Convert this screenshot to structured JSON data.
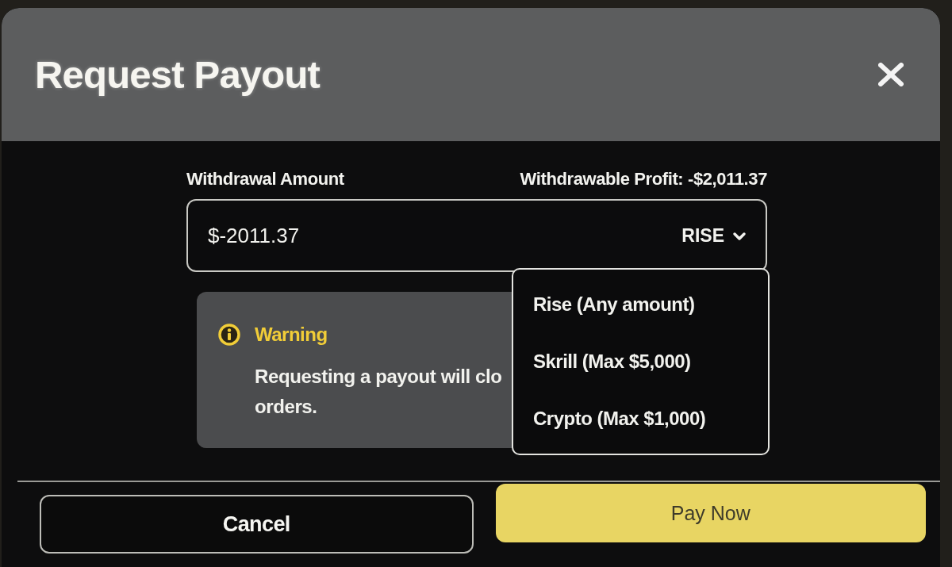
{
  "dialog": {
    "title": "Request Payout"
  },
  "withdrawal": {
    "label": "Withdrawal Amount",
    "profit": "Withdrawable Profit: -$2,011.37",
    "amount": "$-2011.37",
    "method": "RISE"
  },
  "menu": {
    "open": true,
    "options": [
      "Rise (Any amount)",
      "Skrill (Max $5,000)",
      "Crypto (Max $1,000)"
    ]
  },
  "warning": {
    "title": "Warning",
    "lines": [
      "Requesting a payout will clo",
      "orders."
    ]
  },
  "buttons": [
    {
      "label": "Cancel",
      "kind": "secondary"
    },
    {
      "label": "Pay Now",
      "kind": "primary"
    }
  ]
}
